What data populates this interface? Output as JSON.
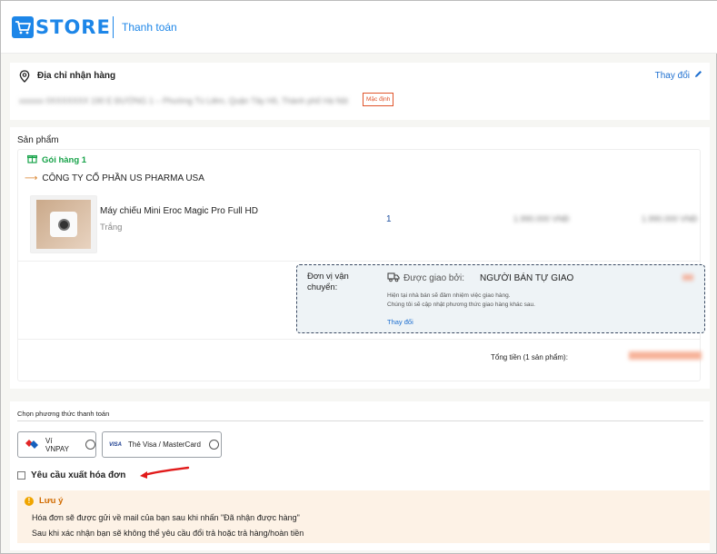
{
  "header": {
    "logo_text": "STORE",
    "title": "Thanh toán"
  },
  "address": {
    "title": "Địa chỉ nhận hàng",
    "change_label": "Thay đổi",
    "line": "xxxxxx 0XXXXXXX 190 E ĐƯỜNG 1 – Phường Tú Liêm, Quận Tây Hồ, Thành phố Hà Nội",
    "default_tag": "Mặc định"
  },
  "products": {
    "header": "Sản phẩm",
    "package_label": "Gói hàng 1",
    "company": "CÔNG TY CỔ PHẦN US PHARMA USA",
    "item": {
      "name": "Máy chiếu Mini Eroc Magic Pro Full HD",
      "variant": "Trắng",
      "quantity": "1",
      "price": "1.990.000 VNĐ",
      "total": "1.990.000 VNĐ"
    },
    "shipping": {
      "key": "Đơn vị vận chuyển:",
      "by_label": "Được giao bởi:",
      "seller": "NGƯỜI BÁN TỰ GIAO",
      "note_1": "Hiện tại nhà bán sẽ đảm nhiệm việc giao hàng.",
      "note_2": "Chúng tôi sẽ cập nhật phương thức giao hàng khác sau.",
      "change_label": "Thay đổi"
    },
    "total_label": "Tổng tiền (1 sản phẩm):",
    "total_value": "1.990.000 VNĐ"
  },
  "payment": {
    "title": "Chọn phương thức thanh toán",
    "options": [
      {
        "label": "Ví VNPAY"
      },
      {
        "label": "Thẻ Visa / MasterCard",
        "mark": "VISA"
      }
    ],
    "invoice_label": "Yêu cầu xuất hóa đơn",
    "notice": {
      "title": "Lưu ý",
      "line_1": "Hóa đơn sẽ được gửi về mail của bạn sau khi nhấn \"Đã nhận được hàng\"",
      "line_2": "Sau khi xác nhận bạn sẽ không thể yêu cầu đổi trả hoặc trả hàng/hoàn tiền"
    }
  },
  "colors": {
    "brand": "#1d86e8",
    "package_green": "#18a34a",
    "notice_orange": "#d16b00",
    "annotation_red": "#e11b1b"
  }
}
